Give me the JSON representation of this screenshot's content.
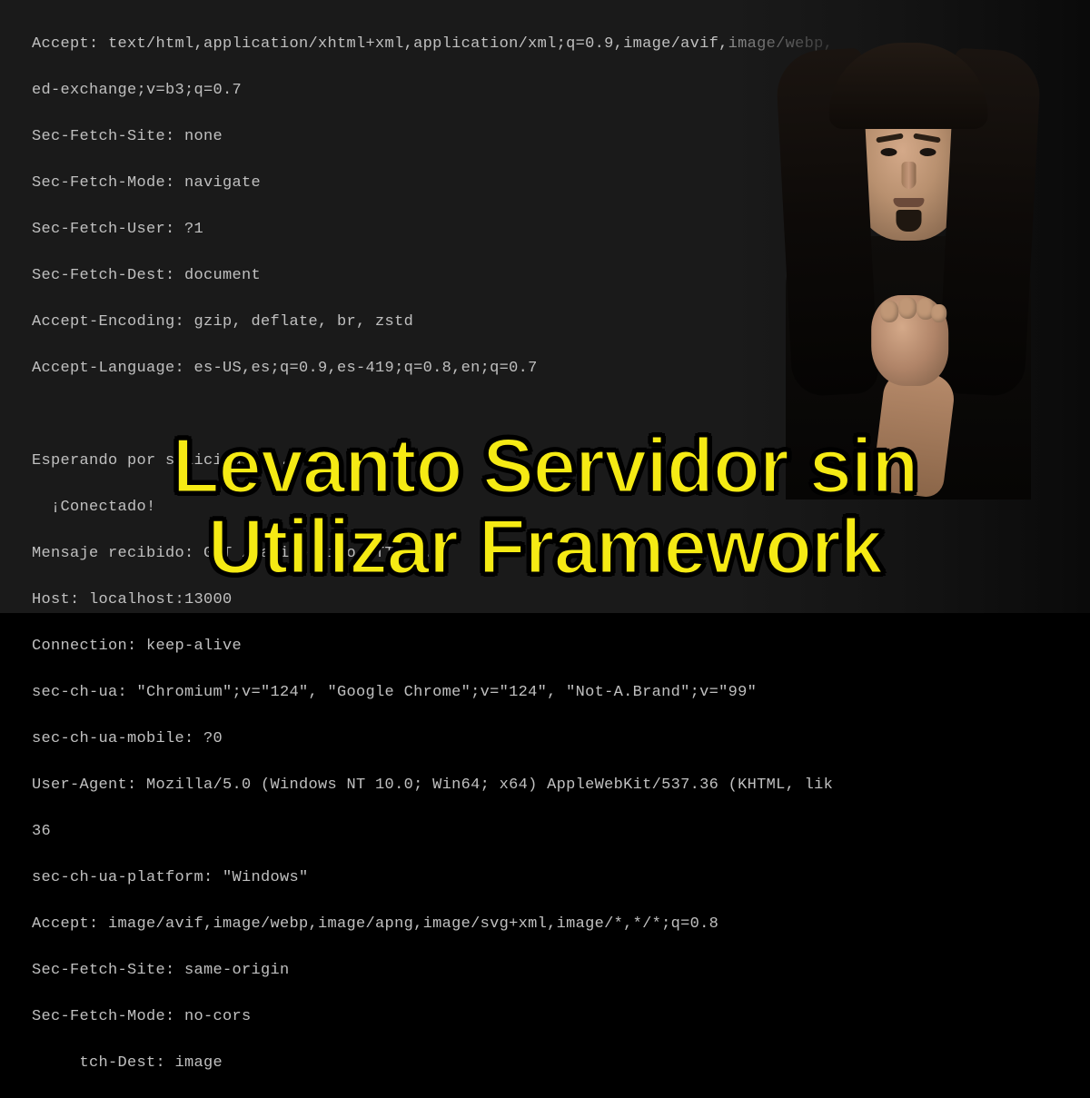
{
  "terminal": {
    "lines": [
      "Accept: text/html,application/xhtml+xml,application/xml;q=0.9,image/avif,image/webp,",
      "ed-exchange;v=b3;q=0.7",
      "Sec-Fetch-Site: none",
      "Sec-Fetch-Mode: navigate",
      "Sec-Fetch-User: ?1",
      "Sec-Fetch-Dest: document",
      "Accept-Encoding: gzip, deflate, br, zstd",
      "Accept-Language: es-US,es;q=0.9,es-419;q=0.8,en;q=0.7",
      "",
      "",
      "Esperando por solicitudes...",
      "  ¡Conectado!",
      "Mensaje recibido: GET /favicon.ico HTTP/1.1",
      "Host: localhost:13000",
      "Connection: keep-alive",
      "sec-ch-ua: \"Chromium\";v=\"124\", \"Google Chrome\";v=\"124\", \"Not-A.Brand\";v=\"99\"",
      "sec-ch-ua-mobile: ?0",
      "User-Agent: Mozilla/5.0 (Windows NT 10.0; Win64; x64) AppleWebKit/537.36 (KHTML, lik",
      "36",
      "sec-ch-ua-platform: \"Windows\"",
      "Accept: image/avif,image/webp,image/apng,image/svg+xml,image/*,*/*;q=0.8",
      "Sec-Fetch-Site: same-origin",
      "Sec-Fetch-Mode: no-cors",
      "     tch-Dest: image"
    ]
  },
  "title": {
    "line1": "Levanto Servidor sin",
    "line2": "Utilizar Framework"
  }
}
